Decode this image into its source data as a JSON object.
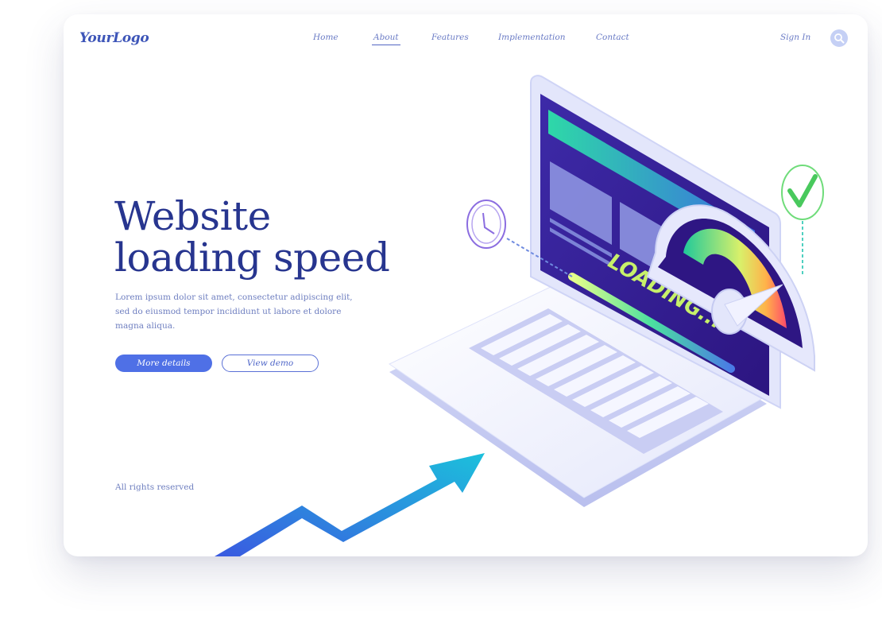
{
  "brand": {
    "logo": "YourLogo"
  },
  "nav": {
    "items": [
      {
        "label": "Home"
      },
      {
        "label": "About",
        "active": true
      },
      {
        "label": "Features"
      },
      {
        "label": "Implementation"
      },
      {
        "label": "Contact"
      }
    ],
    "sign_in": "Sign In",
    "search_icon": "search-icon"
  },
  "hero": {
    "title_line1": "Website",
    "title_line2": "loading speed",
    "description": "Lorem ipsum dolor sit amet, consectetur adipiscing elit, sed do eiusmod tempor incididunt ut labore et dolore magna aliqua."
  },
  "actions": {
    "primary_label": "More details",
    "secondary_label": "View demo"
  },
  "footer": {
    "rights": "All rights reserved"
  },
  "illustration": {
    "screen_text": "LOADING...",
    "icons": [
      "clock-icon",
      "check-icon",
      "speedometer-icon",
      "trend-arrow-icon"
    ]
  },
  "colors": {
    "brand": "#27358f",
    "accent": "#4f70e6",
    "nav_text": "#6a7bc5",
    "screen": "#3a1f9c"
  }
}
